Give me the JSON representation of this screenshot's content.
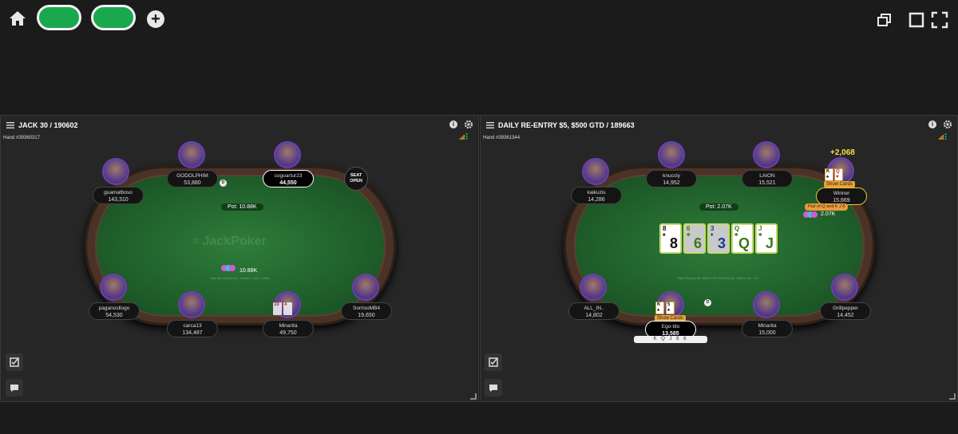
{
  "topbar": {
    "home_icon": "home-icon",
    "add_icon": "plus-icon",
    "add_label": "+"
  },
  "table1": {
    "title": "JACK 30 / 190602",
    "hand": "Hand #39360317",
    "pot": "Pot: 10.88K",
    "logo": "JackPoker",
    "center_info": "Jack 30 Hold'em NL, Stakes 1,300 / 2,600",
    "chip_amount": "10.88K",
    "seat_open": "SEAT OPEN",
    "dealer": "D",
    "players": [
      {
        "name": "guamatboso",
        "stack": "143,310"
      },
      {
        "name": "GODOLPHIM",
        "stack": "53,880"
      },
      {
        "name": "cogoartur23",
        "stack": "44,550"
      },
      {
        "name": "paganosllogo",
        "stack": "54,530"
      },
      {
        "name": "carca13",
        "stack": "134,487"
      },
      {
        "name": "Minarita",
        "stack": "49,750"
      },
      {
        "name": "SorrisoMB4",
        "stack": "19,650"
      }
    ],
    "minarita_cards": [
      "10",
      "4"
    ]
  },
  "table2": {
    "title": "DAILY RE-ENTRY $5, $500 GTD / 189663",
    "hand": "Hand #39361344",
    "pot": "Pot: 2.07K",
    "center_info": "Daily Reentry $5, $500 GTD Hold'em NL, Stakes 50 / 100",
    "chip_amount": "2.07K",
    "dealer": "D",
    "win_amount": "+2,068",
    "winner_label": "Winner",
    "winner_stack": "15,669",
    "show_cards": "Show Cards",
    "winner_hand": "Pair of Q and K J 8",
    "hero_board": "K Q J 8 6",
    "board": [
      {
        "rank": "8",
        "suit": "♠",
        "color": "#111111"
      },
      {
        "rank": "6",
        "suit": "♣",
        "color": "#3a7a1a"
      },
      {
        "rank": "3",
        "suit": "♦",
        "color": "#1a3a9a"
      },
      {
        "rank": "Q",
        "suit": "♣",
        "color": "#3a7a1a"
      },
      {
        "rank": "J",
        "suit": "♣",
        "color": "#3a7a1a"
      }
    ],
    "winner_cards": [
      {
        "rank": "K",
        "suit": "♠",
        "color": "#111111"
      },
      {
        "rank": "Q",
        "suit": "♥",
        "color": "#c01a1a"
      }
    ],
    "hero_cards": [
      {
        "rank": "K",
        "suit": "♠",
        "color": "#111111"
      },
      {
        "rank": "5",
        "suit": "♠",
        "color": "#111111"
      }
    ],
    "players": [
      {
        "name": "kaikuzis",
        "stack": "14,286"
      },
      {
        "name": "knuccly",
        "stack": "14,952"
      },
      {
        "name": "LAION",
        "stack": "15,521"
      },
      {
        "name": "ALL_IN..",
        "stack": "14,802"
      },
      {
        "name": "Ego-tito",
        "stack": "13,585"
      },
      {
        "name": "Minarita",
        "stack": "15,000"
      },
      {
        "name": "Grillpepper",
        "stack": "14,452"
      }
    ]
  },
  "colors": {
    "accent_green": "#1aa84f",
    "gold": "#f2e24a",
    "purple": "#6a3fb0"
  }
}
